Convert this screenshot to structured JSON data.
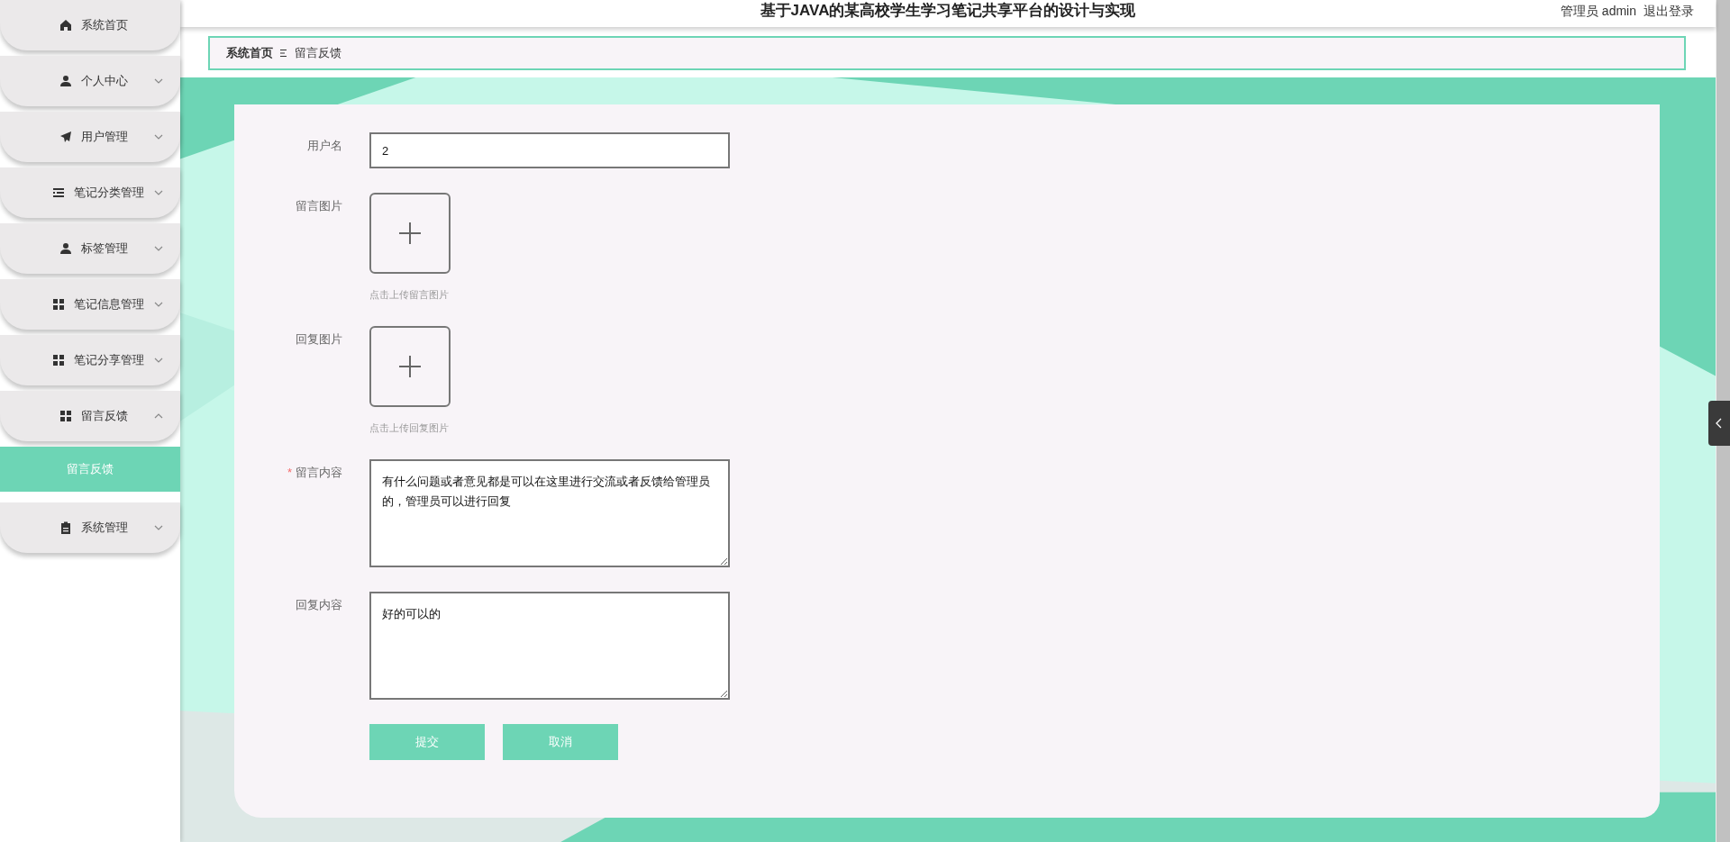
{
  "header": {
    "title": "基于JAVA的某高校学生学习笔记共享平台的设计与实现",
    "user": "管理员 admin",
    "logout": "退出登录"
  },
  "sidebar": {
    "items": [
      {
        "label": "系统首页"
      },
      {
        "label": "个人中心",
        "expanded": false
      },
      {
        "label": "用户管理",
        "expanded": false
      },
      {
        "label": "笔记分类管理",
        "expanded": false
      },
      {
        "label": "标签管理",
        "expanded": false
      },
      {
        "label": "笔记信息管理",
        "expanded": false
      },
      {
        "label": "笔记分享管理",
        "expanded": false
      },
      {
        "label": "留言反馈",
        "expanded": true,
        "children": [
          {
            "label": "留言反馈",
            "selected": true
          }
        ]
      },
      {
        "label": "系统管理",
        "expanded": false
      }
    ]
  },
  "breadcrumb": [
    {
      "label": "系统首页"
    },
    {
      "label": "留言反馈"
    }
  ],
  "form": {
    "fields": [
      {
        "kind": "text",
        "label": "用户名",
        "value": "2"
      },
      {
        "kind": "upload",
        "label": "留言图片",
        "hint": "点击上传留言图片"
      },
      {
        "kind": "upload",
        "label": "回复图片",
        "hint": "点击上传回复图片"
      },
      {
        "kind": "textarea",
        "label": "留言内容",
        "required_mark": "*",
        "value": "有什么问题或者意见都是可以在这里进行交流或者反馈给管理员的，管理员可以进行回复"
      },
      {
        "kind": "textarea",
        "label": "回复内容",
        "value": "好的可以的"
      }
    ],
    "buttons": [
      {
        "label": "提交"
      },
      {
        "label": "取消"
      }
    ]
  }
}
